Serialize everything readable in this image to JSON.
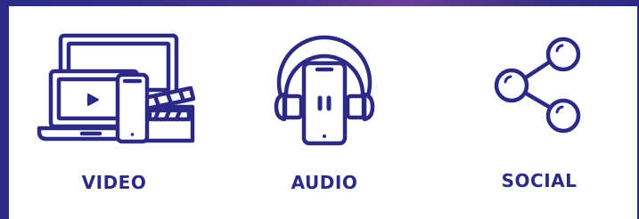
{
  "colors": {
    "primary": "#2d2a86",
    "accent": "#6a3e9c",
    "background": "#ffffff"
  },
  "features": [
    {
      "label": "VIDEO",
      "icon": "video-devices-icon"
    },
    {
      "label": "AUDIO",
      "icon": "headphones-phone-icon"
    },
    {
      "label": "SOCIAL",
      "icon": "share-icon"
    }
  ]
}
